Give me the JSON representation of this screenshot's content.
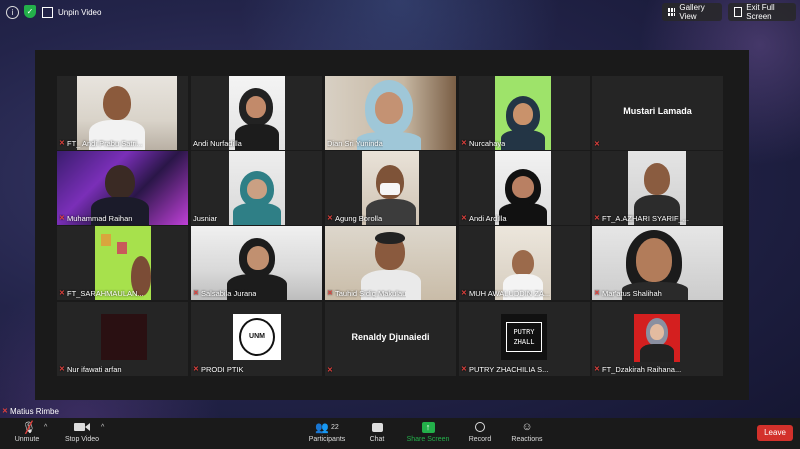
{
  "window": {
    "unpin_label": "Unpin Video",
    "gallery_view_label": "Gallery View",
    "exit_full_screen_label": "Exit Full Screen"
  },
  "participants": [
    {
      "name": "FT_ Andi Prabu Satri...",
      "muted": true
    },
    {
      "name": "Andi Nurfadilla",
      "muted": false
    },
    {
      "name": "Dian Sri Yuninda",
      "muted": false
    },
    {
      "name": "Nurcahaya",
      "muted": true
    },
    {
      "name": "Mustari Lamada",
      "muted": true,
      "center_label": "Mustari Lamada"
    },
    {
      "name": "Muhammad Raihan",
      "muted": true
    },
    {
      "name": "Jusniar",
      "muted": true
    },
    {
      "name": "Agung Borolla",
      "muted": true
    },
    {
      "name": "Andi Ardilla",
      "muted": true
    },
    {
      "name": "FT_A.AZHARI SYARIF_...",
      "muted": true
    },
    {
      "name": "FT_SARAHMAULAN...",
      "muted": true
    },
    {
      "name": "Salsabila Jurana",
      "muted": true
    },
    {
      "name": "Tauhid Sidiq Makulau",
      "muted": true
    },
    {
      "name": "MUH AWALUDDIN ZA...",
      "muted": true
    },
    {
      "name": "Mar'atus Shalihah",
      "muted": true
    },
    {
      "name": "Nur ifawati arfan",
      "muted": true
    },
    {
      "name": "PRODI PTIK",
      "muted": true,
      "logo_text": "UNM"
    },
    {
      "name": "Renaldy Djunaiedi",
      "muted": true,
      "center_label": "Renaldy Djunaiedi"
    },
    {
      "name": "PUTRY ZHACHILIA S...",
      "muted": true,
      "logo_text": "PUTRY ZHALL"
    },
    {
      "name": "FT_Dzakirah Raihana...",
      "muted": true
    }
  ],
  "active_speaker": "Matius Rimbe",
  "toolbar": {
    "unmute": "Unmute",
    "stop_video": "Stop Video",
    "participants": "Participants",
    "participants_count": "22",
    "chat": "Chat",
    "share_screen": "Share Screen",
    "record": "Record",
    "reactions": "Reactions",
    "leave": "Leave"
  },
  "colors": {
    "toolbar_bg": "#1a1a1a",
    "leave_red": "#d3312b",
    "share_green": "#23b04a",
    "mute_red": "#e5413d"
  }
}
